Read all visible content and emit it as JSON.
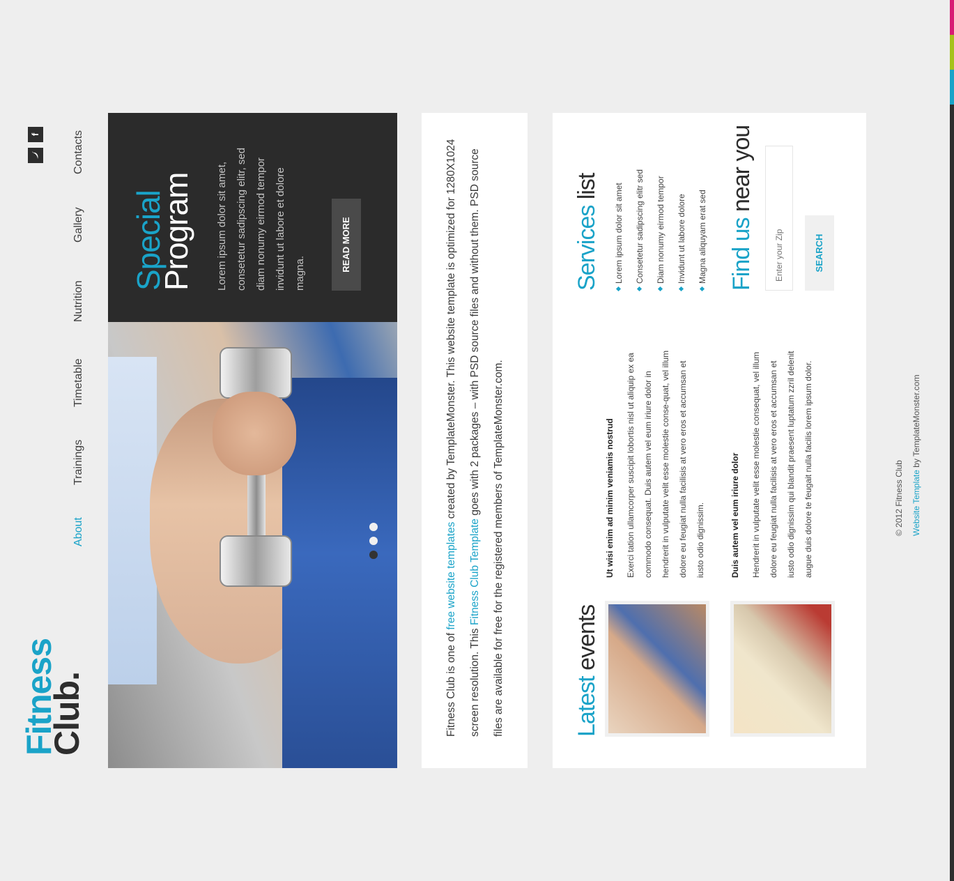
{
  "brand": {
    "logo_line1": "Fitness",
    "logo_line2": "Club."
  },
  "nav": {
    "items": [
      {
        "label": "About",
        "active": true
      },
      {
        "label": "Trainings",
        "active": false
      },
      {
        "label": "Timetable",
        "active": false
      },
      {
        "label": "Nutrition",
        "active": false
      },
      {
        "label": "Gallery",
        "active": false
      },
      {
        "label": "Contacts",
        "active": false
      }
    ]
  },
  "social": {
    "twitter_icon": "twitter-icon",
    "facebook_icon": "facebook-icon",
    "facebook_glyph": "f"
  },
  "slider": {
    "caption_title_accent": "Special",
    "caption_title": "Program",
    "caption_text": "Lorem ipsum dolor sit amet, consetetur sadipscing elitr, sed diam nonumy eirmod tempor invidunt ut labore et dolore magna.",
    "button_label": "READ MORE",
    "dots": 3,
    "active_dot": 0
  },
  "intro": {
    "part1": "Fitness Club is one of ",
    "link1": "free website templates",
    "part2": " created by TemplateMonster. This website template is optimized for 1280X1024 screen resolution. This ",
    "link2": "Fitness Club Template",
    "part3": " goes with 2 packages – with PSD source files and without them. PSD source files are available for free for the registered members of TemplateMonster.com."
  },
  "events": {
    "title_accent": "Latest",
    "title_rest": " events",
    "items": [
      {
        "title": "Ut wisi enim ad minim veniamis nostrud",
        "text": "Exerci tation ullamcorper suscipit lobortis nisl ut aliquip ex ea commodo consequat. Duis autem vel eum iriure dolor in hendrerit in vulputate velit esse molestie conse-quat, vel illum dolore eu feugiat nulla facilisis at vero eros et accumsan et iusto odio dignissim."
      },
      {
        "title": "Duis autem vel eum iriure dolor",
        "text": "Hendrerit in vulputate velit esse molestie consequat, vel illum dolore eu feugiat nulla facilisis at vero eros et accumsan et iusto odio dignissim qui blandit praesent luptatum zzril delenit augue duis dolore te feugait nulla facilis lorem ipsum dolor."
      }
    ]
  },
  "services": {
    "title_accent": "Services",
    "title_rest": " list",
    "items": [
      "Lorem ipsum dolor sit amet",
      "Consetetur sadipscing elitr sed",
      "Diam nonumy eirmod tempor",
      "Invidunt ut labore dolore",
      "Magna aliquyam erat sed"
    ]
  },
  "find": {
    "title_accent": "Find us",
    "title_rest": " near you",
    "zip_placeholder": "Enter your Zip",
    "search_label": "SEARCH"
  },
  "footer": {
    "copyright": "© 2012 Fitness Club",
    "link": "Website Template",
    "by": " by TemplateMonster.com"
  },
  "colors": {
    "accent": "#1aa3c8",
    "dark": "#2b2b2b",
    "stripe": [
      "#2e2e2e",
      "#1aa3c8",
      "#a6c21b",
      "#d81b74"
    ]
  }
}
